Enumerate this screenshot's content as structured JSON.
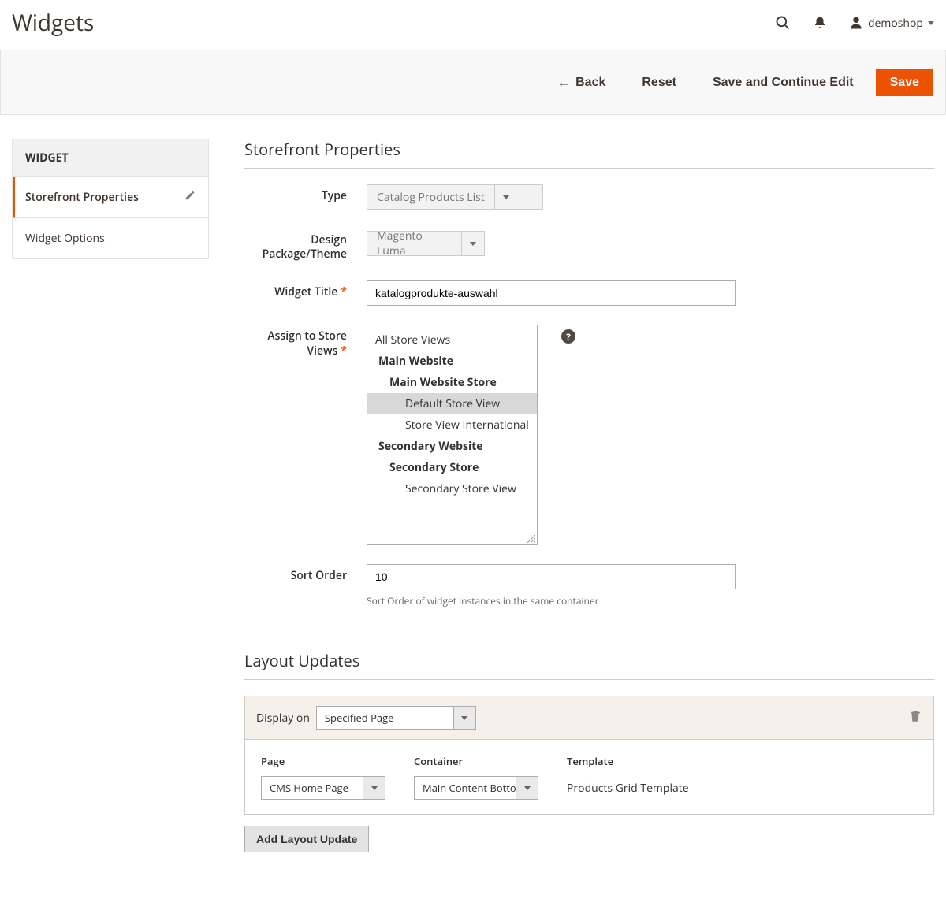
{
  "header": {
    "title": "Widgets",
    "user": "demoshop"
  },
  "toolbar": {
    "back": "Back",
    "reset": "Reset",
    "save_continue": "Save and Continue Edit",
    "save": "Save"
  },
  "sidebar": {
    "section_title": "WIDGET",
    "tab_storefront": "Storefront Properties",
    "tab_options": "Widget Options"
  },
  "storefront": {
    "section_title": "Storefront Properties",
    "type_label": "Type",
    "type_value": "Catalog Products List",
    "theme_label": "Design Package/Theme",
    "theme_value": "Magento Luma",
    "title_label": "Widget Title",
    "title_value": "katalogprodukte-auswahl",
    "assign_label": "Assign to Store Views",
    "store_tree": {
      "all": "All Store Views",
      "main_website": "Main Website",
      "main_store": "Main Website Store",
      "default_view": "Default Store View",
      "intl_view": "Store View International",
      "secondary_website": "Secondary Website",
      "secondary_store": "Secondary Store",
      "secondary_view": "Secondary Store View"
    },
    "sort_label": "Sort Order",
    "sort_value": "10",
    "sort_note": "Sort Order of widget instances in the same container"
  },
  "layout": {
    "section_title": "Layout Updates",
    "display_on_label": "Display on",
    "display_on_value": "Specified Page",
    "page_label": "Page",
    "page_value": "CMS Home Page",
    "container_label": "Container",
    "container_value": "Main Content Bottom",
    "template_label": "Template",
    "template_value": "Products Grid Template",
    "add_button": "Add Layout Update"
  }
}
